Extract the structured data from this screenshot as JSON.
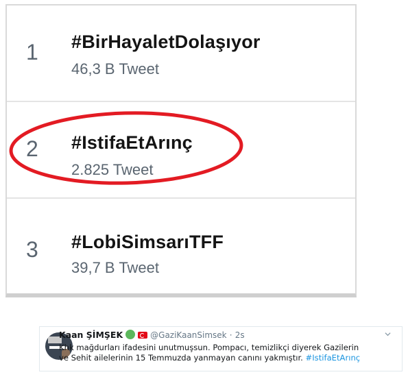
{
  "trends": {
    "items": [
      {
        "rank": "1",
        "name": "#BirHayaletDolaşıyor",
        "count": "46,3 B Tweet"
      },
      {
        "rank": "2",
        "name": "#IstifaEtArınç",
        "count": "2.825 Tweet",
        "highlighted": true
      },
      {
        "rank": "3",
        "name": "#LobiSimsarıTFF",
        "count": "39,7 B Tweet"
      }
    ],
    "highlight_color": "#e31b23"
  },
  "tweet": {
    "display_name": "Kaan ŞİMŞEK",
    "handle": "@GaziKaanSimsek",
    "separator": "·",
    "time": "2s",
    "text_line1": "Khk mağdurları ifadesini unutmuşsun. Pompacı, temizlikçi diyerek Gazilerin",
    "text_line2": "ve Sehit ailelerinin 15 Temmuzda yanmayan canını yakmıştır.",
    "hashtag": "#IstifaEtArınç",
    "icons": [
      "green-circle-icon",
      "turkey-flag-icon",
      "chevron-down-icon"
    ],
    "link_color": "#1b95e0"
  }
}
